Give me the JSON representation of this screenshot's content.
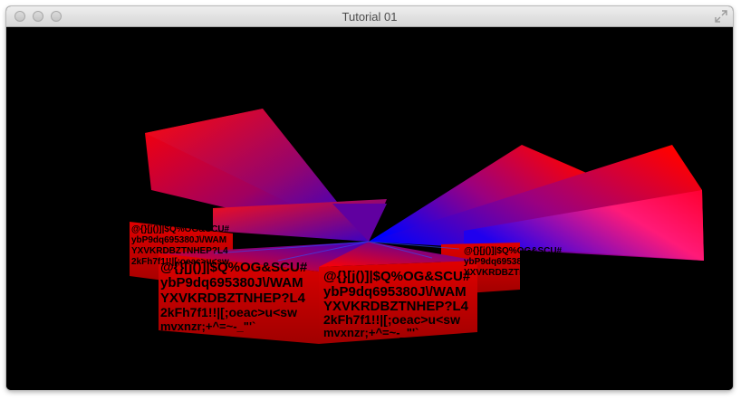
{
  "window": {
    "title": "Tutorial 01",
    "controls": {
      "close": "close-button",
      "minimize": "minimize-button",
      "zoom": "zoom-button",
      "fullscreen": "fullscreen-icon"
    }
  },
  "scene": {
    "background": "#000000",
    "colors": {
      "red": "#ff0000",
      "blue": "#0000ff",
      "pink": "#ff1a6e"
    },
    "texture_lines": [
      "@{}[j()]|$Q%OG&SCU#",
      "ybP9dq695380J\\/WAM",
      "YXVKRDBZTNHEP?L4",
      "2kFh7f1!!|[;oeac>u<sw",
      "mvxnzr;+^=~-_\"'`"
    ]
  }
}
